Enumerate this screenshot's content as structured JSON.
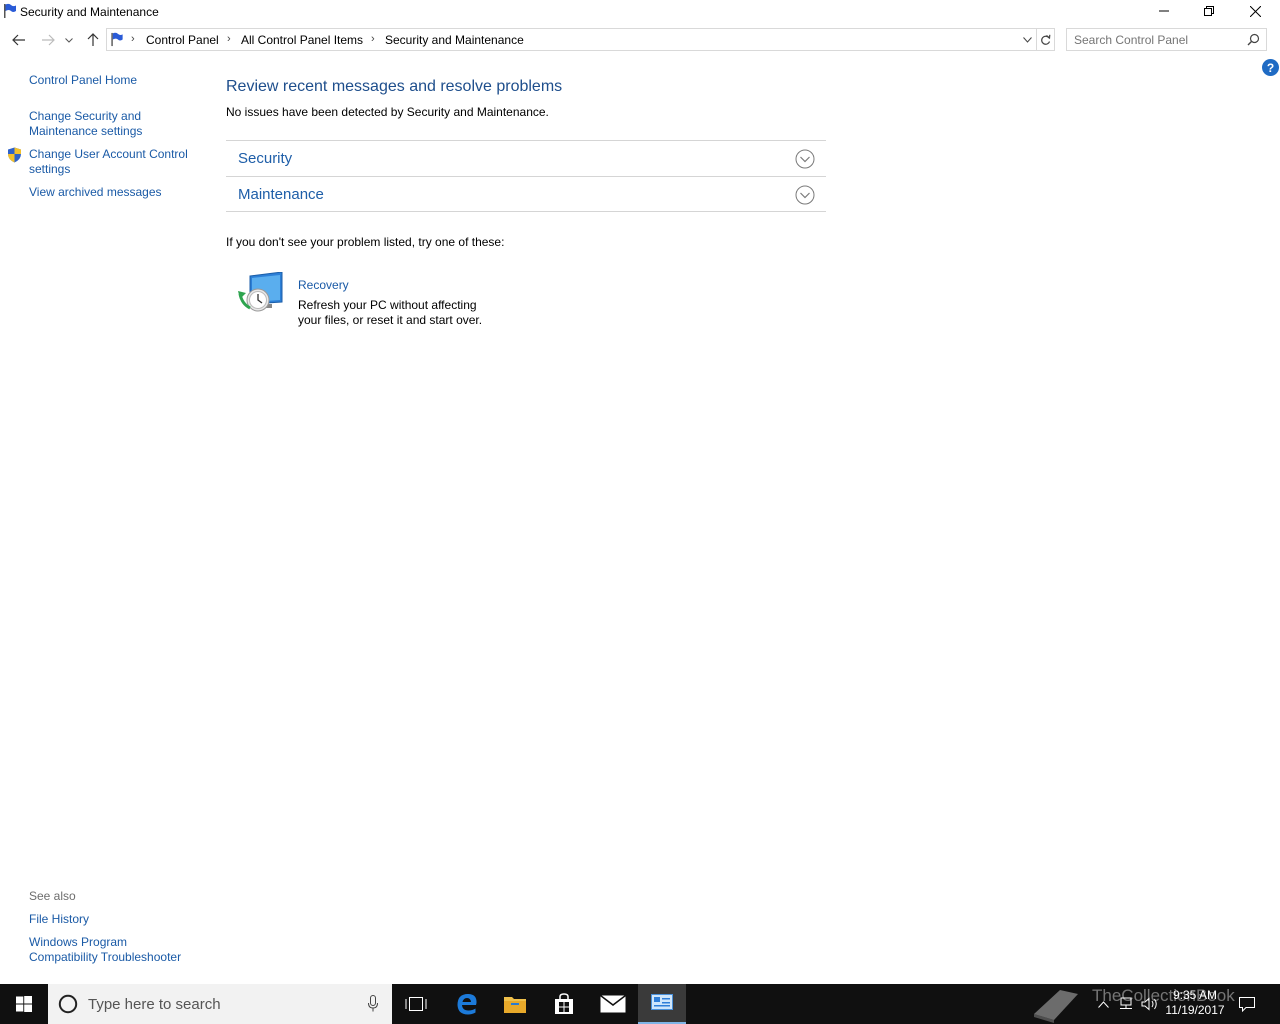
{
  "window": {
    "title": "Security and Maintenance"
  },
  "address": {
    "breadcrumbs": [
      "Control Panel",
      "All Control Panel Items",
      "Security and Maintenance"
    ]
  },
  "search": {
    "placeholder": "Search Control Panel"
  },
  "sidebar": {
    "home": "Control Panel Home",
    "items": [
      {
        "label_line1": "Change Security and",
        "label_line2": "Maintenance settings"
      },
      {
        "label_line1": "Change User Account Control",
        "label_line2": "settings"
      },
      {
        "label_line1": "View archived messages"
      }
    ],
    "see_also_heading": "See also",
    "see_also": [
      {
        "label_line1": "File History"
      },
      {
        "label_line1": "Windows Program",
        "label_line2": "Compatibility Troubleshooter"
      }
    ]
  },
  "main": {
    "title": "Review recent messages and resolve problems",
    "status": "No issues have been detected by Security and Maintenance.",
    "sections": [
      "Security",
      "Maintenance"
    ],
    "try_text": "If you don't see your problem listed, try one of these:",
    "recovery": {
      "link": "Recovery",
      "desc_line1": "Refresh your PC without affecting",
      "desc_line2": "your files, or reset it and start over."
    },
    "help_glyph": "?"
  },
  "taskbar": {
    "search_placeholder": "Type here to search",
    "time": "9:35 AM",
    "date": "11/19/2017",
    "watermark": "TheCollectionBook"
  },
  "colors": {
    "link": "#1a5aa6",
    "heading": "#1e4e8c",
    "taskbar": "#101010"
  }
}
